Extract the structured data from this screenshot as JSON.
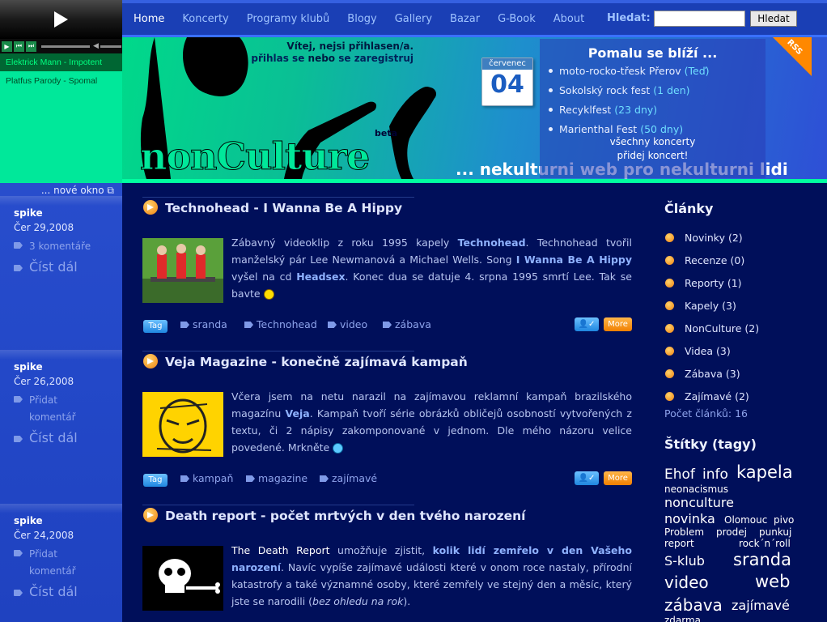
{
  "player": {
    "tracks": [
      "Elektrick Mann - Impotent",
      "Platfus Parody - Spomal"
    ],
    "new_window": "... nové okno"
  },
  "nav": {
    "items": [
      "Home",
      "Koncerty",
      "Programy klubů",
      "Blogy",
      "Gallery",
      "Bazar",
      "G-Book",
      "About"
    ],
    "search_label": "Hledat:",
    "search_value": "",
    "search_button": "Hledat"
  },
  "banner": {
    "welcome_line1": "Vítej, nejsi přihlasen/a.",
    "welcome_login": "přihlas se",
    "welcome_or": "nebo",
    "welcome_register": "se zaregistruj",
    "logo": "nonCulture",
    "beta": "beta",
    "tagline": "... nekulturni web pro nekulturni lidi",
    "rss": "RSS",
    "calendar": {
      "month": "červenec",
      "day": "04"
    },
    "upcoming_title": "Pomalu se blíží ...",
    "upcoming": [
      {
        "name": "moto-rocko-třesk Přerov",
        "when": "(Teď)"
      },
      {
        "name": "Sokolský rock fest",
        "when": "(1 den)"
      },
      {
        "name": "Recyklfest",
        "when": "(23 dny)"
      },
      {
        "name": "Marienthal Fest",
        "when": "(50 dny)"
      }
    ],
    "all_concerts": "všechny koncerty",
    "add_concert": "přidej koncert!"
  },
  "articles": [
    {
      "title": "Technohead - I Wanna Be A Hippy",
      "author": "spike",
      "date": "Čer 29,2008",
      "comments": "3 komentáře",
      "read_more": "Číst dál",
      "body": [
        {
          "t": "Zábavný videoklip z roku 1995 kapely ",
          "b": false
        },
        {
          "t": "Technohead",
          "b": true
        },
        {
          "t": ". Technohead tvořil manželský pár Lee Newmanová a Michael Wells. Song ",
          "b": false
        },
        {
          "t": "I Wanna Be A Hippy",
          "b": true
        },
        {
          "t": " vyšel na cd ",
          "b": false
        },
        {
          "t": "Headsex",
          "b": true
        },
        {
          "t": ". Konec dua se datuje 4. srpna 1995 smrtí Lee. Tak se bavte ",
          "b": false
        }
      ],
      "tag_button": "Tag",
      "tags": [
        "sranda",
        "Technohead",
        "video",
        "zábava"
      ],
      "more": "More"
    },
    {
      "title": "Veja Magazine - konečně zajímavá kampaň",
      "author": "spike",
      "date": "Čer 26,2008",
      "comments": "Přidat komentář",
      "read_more": "Číst dál",
      "body": [
        {
          "t": "Včera jsem na netu narazil na zajímavou reklamní kampaň brazilského magazínu ",
          "b": false
        },
        {
          "t": "Veja",
          "b": true
        },
        {
          "t": ". Kampaň tvoří série obrázků obličejů osobností vytvořených z textu, či 2 nápisy zakomponované v jednom. Dle mého názoru velice povedené. Mrkněte ",
          "b": false
        }
      ],
      "tag_button": "Tag",
      "tags": [
        "kampaň",
        "magazine",
        "zajímavé"
      ],
      "more": "More"
    },
    {
      "title": "Death report - počet mrtvých v den tvého narození",
      "author": "spike",
      "date": "Čer 24,2008",
      "comments": "Přidat komentář",
      "read_more": "Číst dál",
      "body": [
        {
          "t": "The Death Report",
          "b": false,
          "w": true
        },
        {
          "t": " umožňuje zjistit, ",
          "b": false
        },
        {
          "t": "kolik lidí zemřelo v den Vašeho narození",
          "b": true
        },
        {
          "t": ". Navíc vypíše zajímavé události které v onom roce nastaly, přírodní katastrofy a také významné osoby, které zemřely ve stejný den a měsíc, který jste se narodili (",
          "b": false
        },
        {
          "t": "bez ohledu na rok",
          "b": false,
          "i": true
        },
        {
          "t": ").",
          "b": false
        }
      ]
    }
  ],
  "sidebar": {
    "articles_title": "Články",
    "categories": [
      {
        "name": "Novinky",
        "count": "(2)"
      },
      {
        "name": "Recenze",
        "count": "(0)"
      },
      {
        "name": "Reporty",
        "count": "(1)"
      },
      {
        "name": "Kapely",
        "count": "(3)"
      },
      {
        "name": "NonCulture",
        "count": "(2)"
      },
      {
        "name": "Videa",
        "count": "(3)"
      },
      {
        "name": "Zábava",
        "count": "(3)"
      },
      {
        "name": "Zajímavé",
        "count": "(2)"
      }
    ],
    "article_count": "Počet článků: 16",
    "tags_title": "Štítky (tagy)",
    "cloud": [
      "Ehof",
      "info",
      "kapela",
      "neonacismus",
      "nonculture",
      "novinka",
      "Olomouc",
      "pivo",
      "Problem",
      "prodej",
      "punkuj",
      "report",
      "rock´n´roll",
      "S-klub",
      "sranda",
      "video",
      "web",
      "zábava",
      "zajímavé",
      "zdarma"
    ]
  }
}
